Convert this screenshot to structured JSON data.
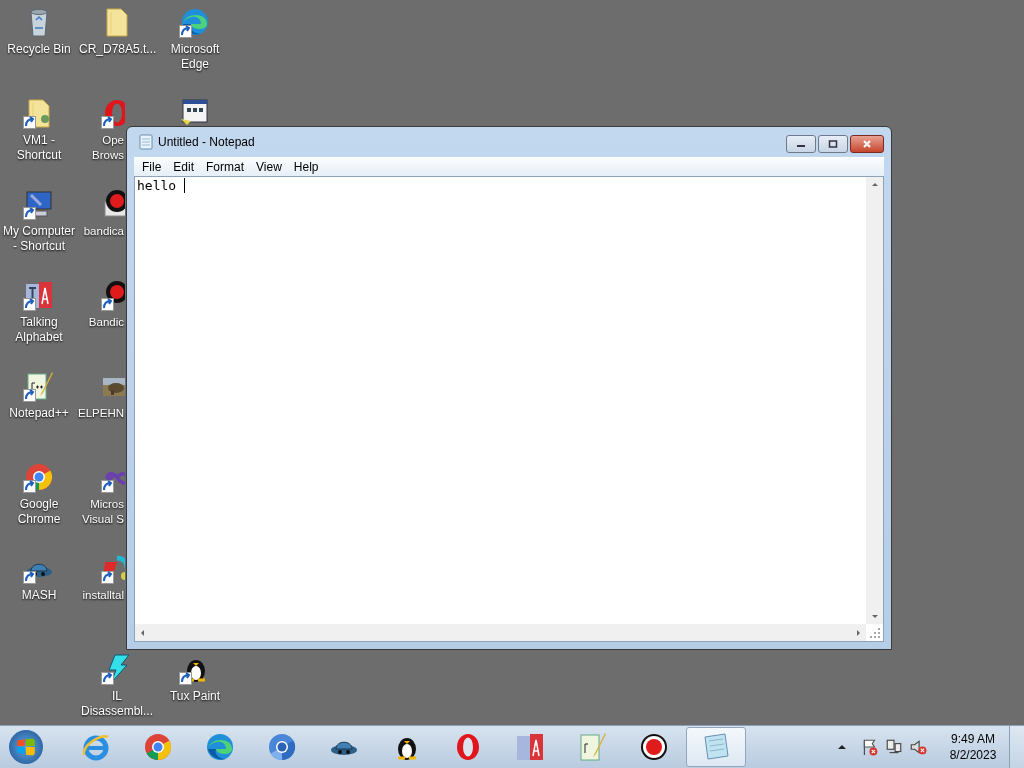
{
  "desktop_icons": [
    {
      "kind": "recycle",
      "label": "Recycle Bin",
      "shortcut": false,
      "clipped": false
    },
    {
      "kind": "folder-user",
      "label": "VM1 - Shortcut",
      "shortcut": true,
      "clipped": false
    },
    {
      "kind": "computer",
      "label": "My Computer - Shortcut",
      "shortcut": true,
      "clipped": false
    },
    {
      "kind": "alphabet",
      "label": "Talking Alphabet",
      "shortcut": true,
      "clipped": false
    },
    {
      "kind": "notepadpp",
      "label": "Notepad++",
      "shortcut": true,
      "clipped": false
    },
    {
      "kind": "chrome",
      "label": "Google Chrome",
      "shortcut": true,
      "clipped": false
    },
    {
      "kind": "mash",
      "label": "MASH",
      "shortcut": true,
      "clipped": false
    },
    {
      "kind": "folder",
      "label": "CR_D78A5.t...",
      "shortcut": false,
      "clipped": false
    },
    {
      "kind": "opera",
      "label": "Ope\nBrows",
      "shortcut": true,
      "clipped": true
    },
    {
      "kind": "bandibox",
      "label": "bandica",
      "shortcut": false,
      "clipped": true
    },
    {
      "kind": "bandicam",
      "label": "Bandic",
      "shortcut": true,
      "clipped": true
    },
    {
      "kind": "photo",
      "label": "ELPEHN",
      "shortcut": false,
      "clipped": true
    },
    {
      "kind": "vs",
      "label": "Micros\nVisual S",
      "shortcut": true,
      "clipped": true
    },
    {
      "kind": "install",
      "label": "installtal",
      "shortcut": true,
      "clipped": true
    },
    {
      "kind": "edge",
      "label": "Microsoft Edge",
      "shortcut": true,
      "clipped": false
    },
    {
      "kind": "program",
      "shortcut": false,
      "clipped": true
    }
  ],
  "bottom_icons": [
    {
      "kind": "ildasm",
      "label": "IL Disassembl...",
      "shortcut": true,
      "clipped": false
    },
    {
      "kind": "tux",
      "label": "Tux Paint",
      "shortcut": true,
      "clipped": false
    }
  ],
  "window": {
    "title": "Untitled - Notepad",
    "menu": [
      "File",
      "Edit",
      "Format",
      "View",
      "Help"
    ],
    "text": "hello "
  },
  "taskbar": {
    "items": [
      {
        "kind": "ie",
        "selected": false
      },
      {
        "kind": "chrome",
        "selected": false
      },
      {
        "kind": "edge",
        "selected": false
      },
      {
        "kind": "chromium",
        "selected": false
      },
      {
        "kind": "mash",
        "selected": false
      },
      {
        "kind": "tux",
        "selected": false
      },
      {
        "kind": "opera",
        "selected": false
      },
      {
        "kind": "alphabet",
        "selected": false
      },
      {
        "kind": "notepadpp",
        "selected": false
      },
      {
        "kind": "bandicam",
        "selected": false
      },
      {
        "kind": "notepad",
        "selected": true
      }
    ],
    "time": "9:49 AM",
    "date": "8/2/2023"
  }
}
